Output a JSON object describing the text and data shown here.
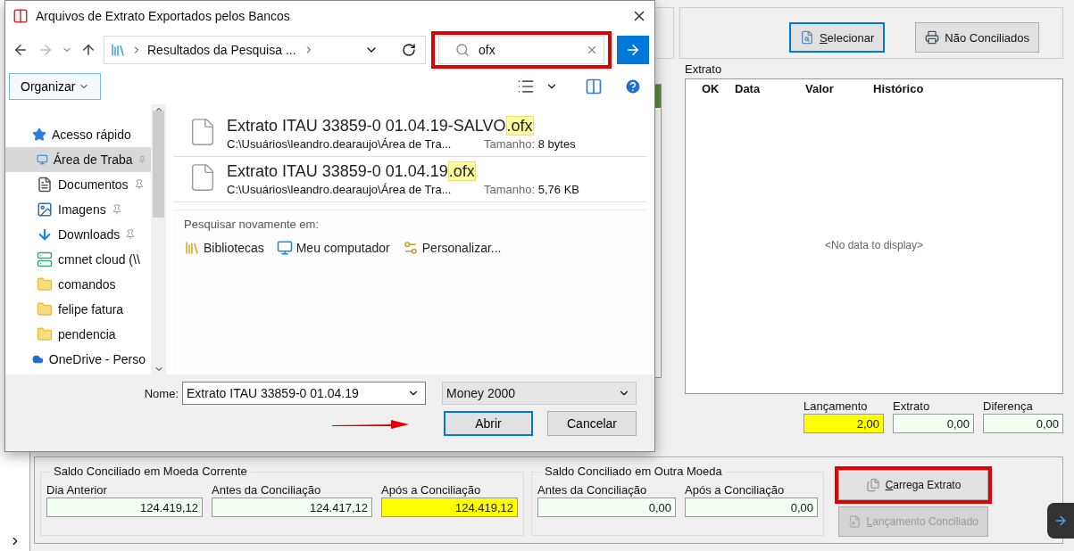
{
  "app": {
    "toolbar_buttons": [
      {
        "label": "Selecionar",
        "mnemonic": true,
        "focused": true,
        "kind": "search"
      },
      {
        "label": "Não Conciliados",
        "mnemonic": false,
        "focused": false,
        "kind": "print"
      }
    ],
    "statement": {
      "title": "Extrato",
      "columns": [
        "OK",
        "Data",
        "Valor",
        "Histórico"
      ],
      "empty_text": "<No data to display>"
    },
    "totals": [
      {
        "label": "Lançamento",
        "value": "2,00",
        "highlighted": true
      },
      {
        "label": "Extrato",
        "value": "0,00",
        "highlighted": false
      },
      {
        "label": "Diferença",
        "value": "0,00",
        "highlighted": false
      }
    ],
    "groups": [
      {
        "title": "Saldo Conciliado em Moeda Corrente",
        "fields": [
          {
            "label": "Dia Anterior",
            "value": "124.419,12",
            "highlighted": false
          },
          {
            "label": "Antes da Conciliação",
            "value": "124.417,12",
            "highlighted": false
          },
          {
            "label": "Após a Conciliação",
            "value": "124.419,12",
            "highlighted": true
          }
        ]
      },
      {
        "title": "Saldo Conciliado em Outra Moeda",
        "fields": [
          {
            "label": "Antes da Conciliação",
            "value": "0,00",
            "highlighted": false
          },
          {
            "label": "Após a Conciliação",
            "value": "0,00",
            "highlighted": false
          }
        ]
      }
    ],
    "actions": [
      {
        "label": "Carrega Extrato",
        "mnemonic": true,
        "disabled": false,
        "annotated": true
      },
      {
        "label": "Lançamento Conciliado",
        "mnemonic": true,
        "disabled": true,
        "annotated": false
      }
    ]
  },
  "dialog": {
    "title": "Arquivos de Extrato Exportados pelos Bancos",
    "breadcrumb": "Resultados da Pesquisa ...",
    "search": {
      "value": "ofx",
      "annotated": true
    },
    "organize": "Organizar",
    "sidebar": [
      {
        "label": "Acesso rápido",
        "kind": "star",
        "selected": false,
        "pinned": false,
        "children": [
          {
            "label": "Área de Traba",
            "kind": "desktop",
            "selected": true,
            "pinned": true
          },
          {
            "label": "Documentos",
            "kind": "documents",
            "selected": false,
            "pinned": true
          },
          {
            "label": "Imagens",
            "kind": "images",
            "selected": false,
            "pinned": true
          },
          {
            "label": "Downloads",
            "kind": "downloads",
            "selected": false,
            "pinned": true
          },
          {
            "label": "cmnet cloud (\\\\",
            "kind": "network",
            "selected": false,
            "pinned": false
          },
          {
            "label": "comandos",
            "kind": "folder",
            "selected": false,
            "pinned": false
          },
          {
            "label": "felipe fatura",
            "kind": "folder",
            "selected": false,
            "pinned": false
          },
          {
            "label": "pendencia",
            "kind": "folder",
            "selected": false,
            "pinned": false
          }
        ]
      },
      {
        "label": "OneDrive - Perso",
        "kind": "cloud",
        "selected": false,
        "pinned": false
      }
    ],
    "results": [
      {
        "name": "Extrato ITAU 33859-0 01.04.19-SALVO",
        "match": ".ofx",
        "path": "C:\\Usuários\\leandro.dearaujo\\Área de Tra...",
        "size_label": "Tamanho:",
        "size": "8 bytes"
      },
      {
        "name": "Extrato ITAU 33859-0 01.04.19",
        "match": ".ofx",
        "path": "C:\\Usuários\\leandro.dearaujo\\Área de Tra...",
        "size_label": "Tamanho:",
        "size": "5,76 KB"
      }
    ],
    "search_again": {
      "label": "Pesquisar novamente em:",
      "locations": [
        {
          "label": "Bibliotecas",
          "kind": "libraries"
        },
        {
          "label": "Meu computador",
          "kind": "computer"
        },
        {
          "label": "Personalizar...",
          "kind": "custom"
        }
      ]
    },
    "filename": {
      "label": "Nome:",
      "value": "Extrato ITAU 33859-0 01.04.19"
    },
    "filetype": "Money 2000",
    "buttons": [
      {
        "label": "Abrir",
        "default": true
      },
      {
        "label": "Cancelar",
        "default": false
      }
    ]
  }
}
